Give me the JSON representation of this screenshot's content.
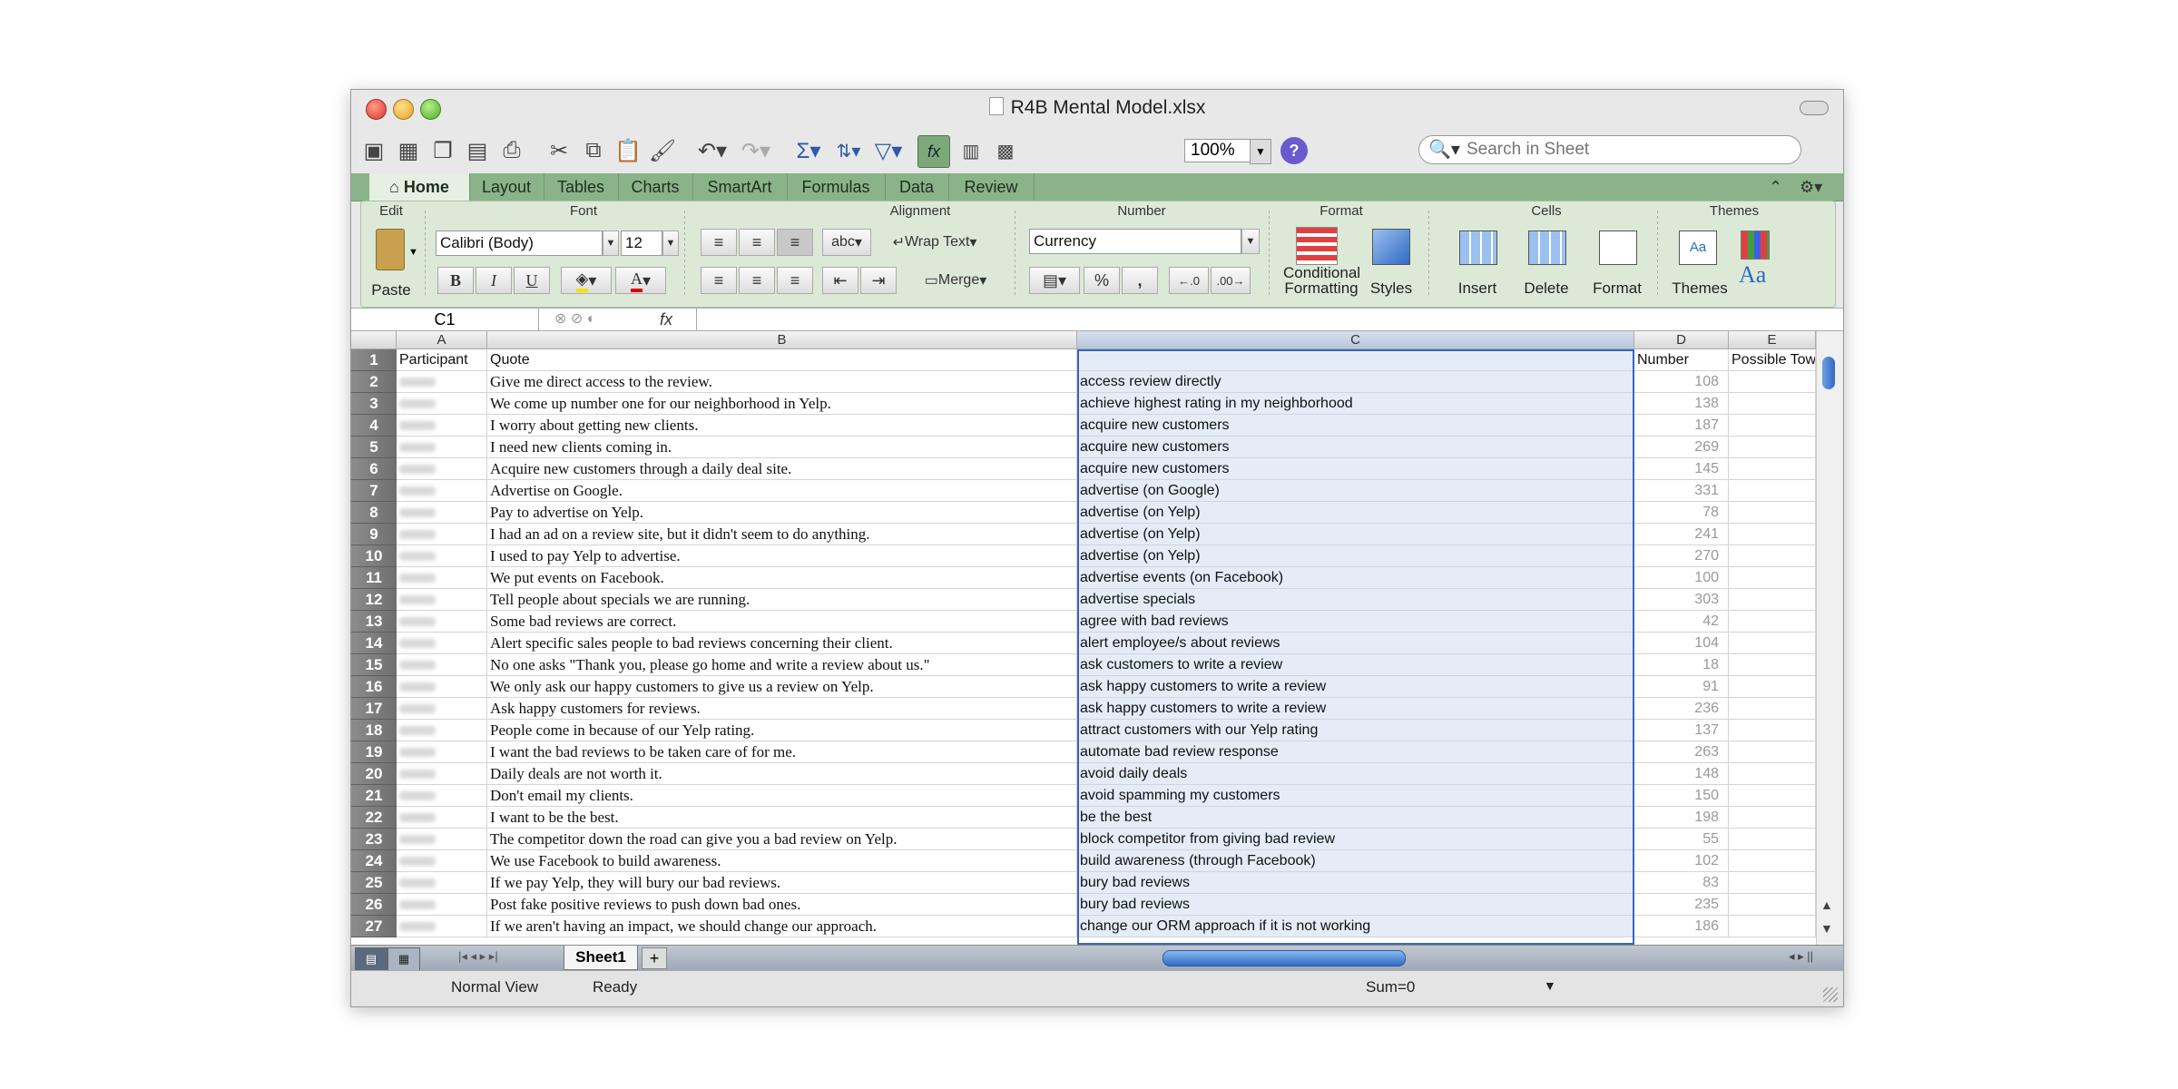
{
  "window": {
    "title": "R4B Mental Model.xlsx"
  },
  "toolbar": {
    "zoom": "100%",
    "search_placeholder": "Search in Sheet"
  },
  "ribbon_tabs": [
    "Home",
    "Layout",
    "Tables",
    "Charts",
    "SmartArt",
    "Formulas",
    "Data",
    "Review"
  ],
  "ribbon": {
    "groups": {
      "edit": "Edit",
      "font": "Font",
      "alignment": "Alignment",
      "number": "Number",
      "format": "Format",
      "cells": "Cells",
      "themes": "Themes"
    },
    "paste": "Paste",
    "font_name": "Calibri (Body)",
    "font_size": "12",
    "bold": "B",
    "italic": "I",
    "underline": "U",
    "abc": "abc",
    "wrap_text": "Wrap Text",
    "merge": "Merge",
    "number_format": "Currency",
    "percent": "%",
    "comma": ",",
    "conditional_formatting_1": "Conditional",
    "conditional_formatting_2": "Formatting",
    "styles": "Styles",
    "insert": "Insert",
    "delete": "Delete",
    "format": "Format",
    "themes": "Themes",
    "themes_aa": "Aa"
  },
  "formula_bar": {
    "name_box": "C1",
    "fx": "fx",
    "content": ""
  },
  "columns": [
    "A",
    "B",
    "C",
    "D",
    "E"
  ],
  "header_row": {
    "a": "Participant",
    "b": "Quote",
    "c": "",
    "d": "Number",
    "e": "Possible Tow"
  },
  "rows": [
    {
      "n": "2",
      "b": "Give me direct access to the review.",
      "c": "access review directly",
      "d": "108"
    },
    {
      "n": "3",
      "b": "We come up number one for our neighborhood in Yelp.",
      "c": "achieve highest rating in my neighborhood",
      "d": "138"
    },
    {
      "n": "4",
      "b": "I worry about getting new clients.",
      "c": "acquire new customers",
      "d": "187"
    },
    {
      "n": "5",
      "b": "I need new clients coming in.",
      "c": "acquire new customers",
      "d": "269"
    },
    {
      "n": "6",
      "b": "Acquire new customers through a daily deal site.",
      "c": "acquire new customers",
      "d": "145"
    },
    {
      "n": "7",
      "b": "Advertise on Google.",
      "c": "advertise (on Google)",
      "d": "331"
    },
    {
      "n": "8",
      "b": "Pay to advertise on Yelp.",
      "c": "advertise (on Yelp)",
      "d": "78"
    },
    {
      "n": "9",
      "b": "I had an ad on a review site, but it didn't seem to do anything.",
      "c": "advertise (on Yelp)",
      "d": "241"
    },
    {
      "n": "10",
      "b": "I used to pay Yelp to advertise.",
      "c": "advertise (on Yelp)",
      "d": "270"
    },
    {
      "n": "11",
      "b": "We put events on Facebook.",
      "c": "advertise events (on Facebook)",
      "d": "100"
    },
    {
      "n": "12",
      "b": "Tell people about specials we are running.",
      "c": "advertise specials",
      "d": "303"
    },
    {
      "n": "13",
      "b": "Some bad reviews are correct.",
      "c": "agree with bad reviews",
      "d": "42"
    },
    {
      "n": "14",
      "b": "Alert specific sales people to bad reviews concerning their client.",
      "c": "alert employee/s about reviews",
      "d": "104"
    },
    {
      "n": "15",
      "b": "No one asks \"Thank you, please go home and write a review about us.\"",
      "c": "ask customers to write a review",
      "d": "18"
    },
    {
      "n": "16",
      "b": "We only ask our happy customers to give us a review on Yelp.",
      "c": "ask happy customers to write a review",
      "d": "91"
    },
    {
      "n": "17",
      "b": "Ask happy customers for reviews.",
      "c": "ask happy customers to write a review",
      "d": "236"
    },
    {
      "n": "18",
      "b": "People come in because of our Yelp rating.",
      "c": "attract customers with our Yelp rating",
      "d": "137"
    },
    {
      "n": "19",
      "b": "I want the bad reviews to be taken care of for me.",
      "c": "automate bad review response",
      "d": "263"
    },
    {
      "n": "20",
      "b": "Daily deals are not worth it.",
      "c": "avoid daily deals",
      "d": "148"
    },
    {
      "n": "21",
      "b": "Don't email my clients.",
      "c": "avoid spamming my customers",
      "d": "150"
    },
    {
      "n": "22",
      "b": "I want to be the best.",
      "c": "be the best",
      "d": "198"
    },
    {
      "n": "23",
      "b": "The competitor down the road can give you a bad review on Yelp.",
      "c": "block competitor from giving bad review",
      "d": "55"
    },
    {
      "n": "24",
      "b": "We use Facebook to build awareness.",
      "c": "build awareness (through Facebook)",
      "d": "102"
    },
    {
      "n": "25",
      "b": "If we pay Yelp, they will bury our bad reviews.",
      "c": "bury bad reviews",
      "d": "83"
    },
    {
      "n": "26",
      "b": "Post fake positive reviews to push down bad ones.",
      "c": "bury bad reviews",
      "d": "235"
    },
    {
      "n": "27",
      "b": "If we aren't having an impact, we should change our approach.",
      "c": "change our ORM approach if it is not working",
      "d": "186"
    }
  ],
  "sheet_tab": "Sheet1",
  "status": {
    "view": "Normal View",
    "state": "Ready",
    "sum": "Sum=0"
  }
}
